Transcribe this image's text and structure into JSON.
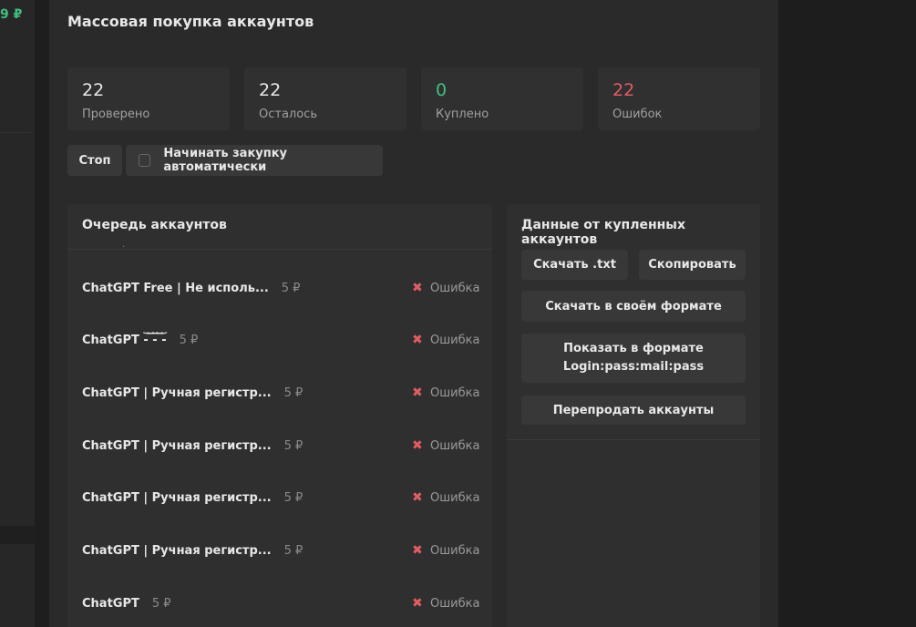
{
  "left": {
    "balance": "9 ₽"
  },
  "page": {
    "title": "Массовая покупка аккаунтов"
  },
  "stats": {
    "checked": {
      "value": "22",
      "label": "Проверено",
      "color": "#e8e8e8"
    },
    "remaining": {
      "value": "22",
      "label": "Осталось",
      "color": "#e8e8e8"
    },
    "bought": {
      "value": "0",
      "label": "Куплено",
      "color": "#3fbf7f"
    },
    "errors": {
      "value": "22",
      "label": "Ошибок",
      "color": "#e05d63"
    }
  },
  "controls": {
    "stop_label": "Стоп",
    "auto_buy_label": "Начинать закупку автоматически",
    "auto_buy_checked": false
  },
  "queue": {
    "title": "Очередь аккаунтов",
    "partial_item": "·",
    "items": [
      {
        "name": "ChatGPT Free | Не исполь...",
        "price": "5 ₽",
        "status": "Ошибка"
      },
      {
        "name": "ChatGPT -͝ ͝-͝ ͝-",
        "price": "5 ₽",
        "status": "Ошибка"
      },
      {
        "name": "ChatGPT | Ручная регистр...",
        "price": "5 ₽",
        "status": "Ошибка"
      },
      {
        "name": "ChatGPT | Ручная регистр...",
        "price": "5 ₽",
        "status": "Ошибка"
      },
      {
        "name": "ChatGPT | Ручная регистр...",
        "price": "5 ₽",
        "status": "Ошибка"
      },
      {
        "name": "ChatGPT | Ручная регистр...",
        "price": "5 ₽",
        "status": "Ошибка"
      },
      {
        "name": "ChatGPT",
        "price": "5 ₽",
        "status": "Ошибка"
      }
    ]
  },
  "purchased_data": {
    "title": "Данные от купленных аккаунтов",
    "download_txt_label": "Скачать .txt",
    "copy_label": "Скопировать",
    "download_custom_label": "Скачать в своём формате",
    "show_format_line1": "Показать в формате",
    "show_format_line2": "Login:pass:mail:pass",
    "resell_label": "Перепродать аккаунты"
  },
  "icons": {
    "error": "x-mark-icon"
  }
}
